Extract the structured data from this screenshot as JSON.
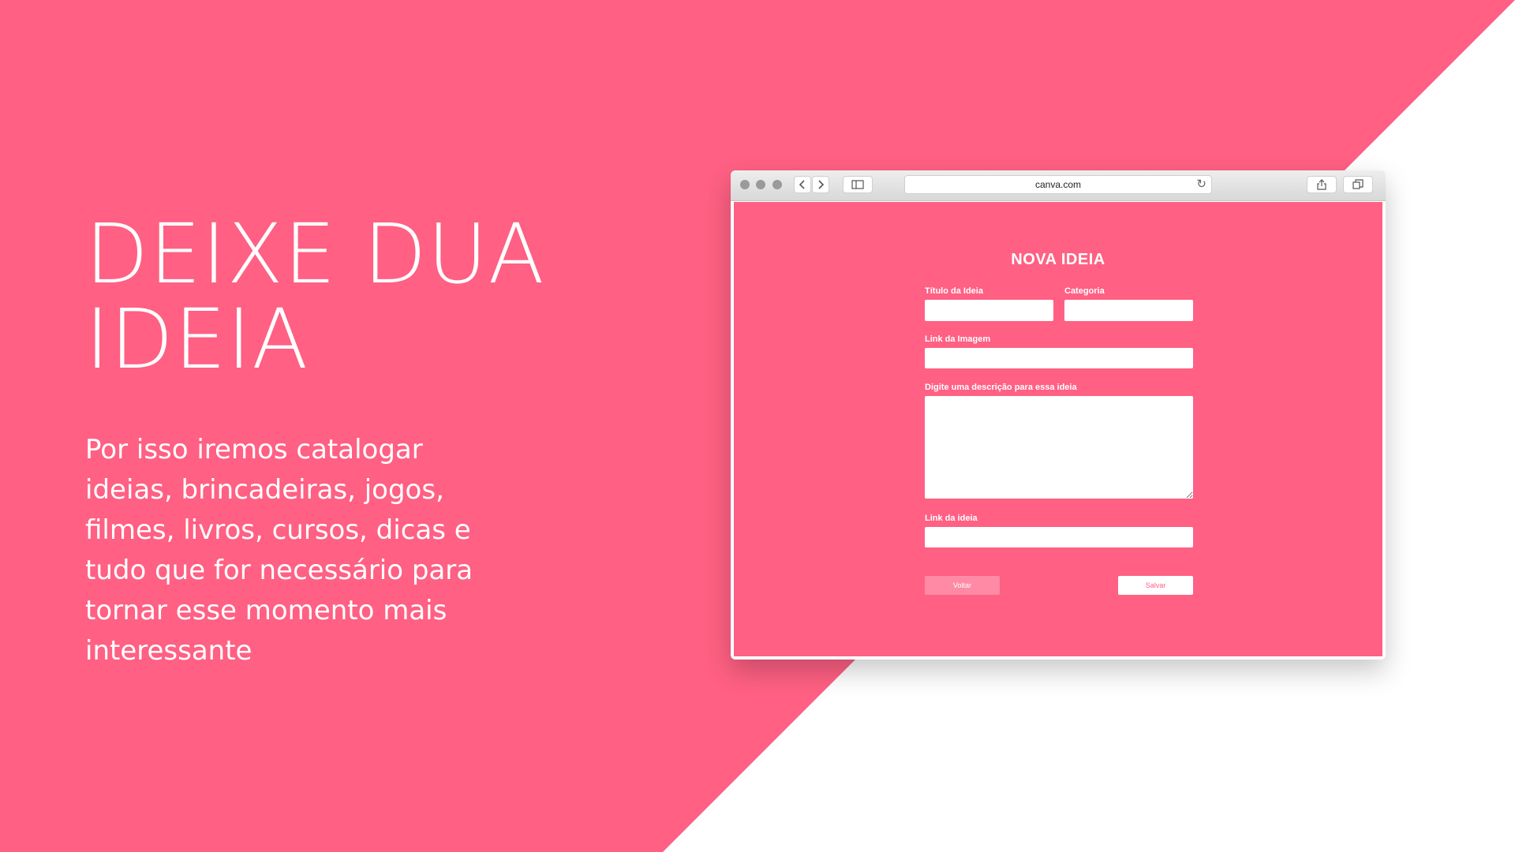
{
  "colors": {
    "brand_pink": "#ff6083",
    "white": "#ffffff"
  },
  "slide": {
    "headline_lines": [
      "DEIXE DUA",
      "IDEIA"
    ],
    "body_lines": [
      "Por isso iremos catalogar",
      "ideias, brincadeiras, jogos,",
      "filmes, livros, cursos, dicas e",
      "tudo que for necessário para",
      "tornar esse momento mais",
      "interessante"
    ]
  },
  "browser": {
    "url": "canva.com",
    "icons": [
      "back-arrow-icon",
      "forward-arrow-icon",
      "sidebar-icon",
      "reload-icon",
      "share-icon",
      "tabs-icon"
    ]
  },
  "form": {
    "title": "NOVA IDEIA",
    "fields": {
      "titulo": {
        "label": "Título da Ideia",
        "value": "",
        "placeholder": ""
      },
      "categoria": {
        "label": "Categoria",
        "value": "",
        "placeholder": ""
      },
      "link_imagem": {
        "label": "Link da Imagem",
        "value": "",
        "placeholder": ""
      },
      "descricao": {
        "label": "Digite uma descrição para essa ideia",
        "value": "",
        "placeholder": ""
      },
      "link_ideia": {
        "label": "Link da ideia",
        "value": "",
        "placeholder": ""
      }
    },
    "buttons": {
      "voltar": "Voltar",
      "salvar": "Salvar"
    }
  }
}
